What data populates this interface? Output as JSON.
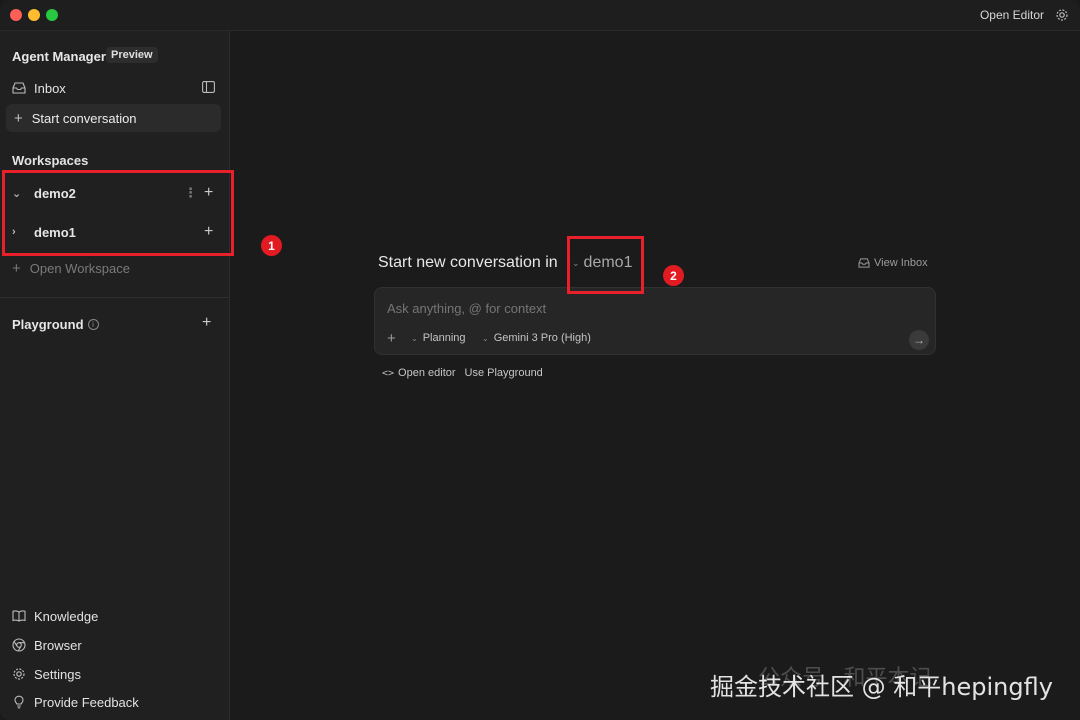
{
  "titlebar": {
    "open_editor": "Open Editor"
  },
  "sidebar": {
    "title": "Agent Manager",
    "badge": "Preview",
    "inbox": "Inbox",
    "start_conversation": "Start conversation",
    "workspaces_header": "Workspaces",
    "workspaces": [
      {
        "name": "demo2",
        "expanded": true
      },
      {
        "name": "demo1",
        "expanded": false
      }
    ],
    "open_workspace": "Open Workspace",
    "playground": "Playground",
    "bottom": {
      "knowledge": "Knowledge",
      "browser": "Browser",
      "settings": "Settings",
      "feedback": "Provide Feedback"
    }
  },
  "main": {
    "title": "Start new conversation in",
    "workspace_selected": "demo1",
    "view_inbox": "View Inbox",
    "composer": {
      "placeholder": "Ask anything, @ for context",
      "mode": "Planning",
      "model": "Gemini 3 Pro (High)"
    },
    "links": {
      "open_editor": "Open editor",
      "use_playground": "Use Playground"
    }
  },
  "annotations": {
    "one": "1",
    "two": "2",
    "color": "#e21b22"
  },
  "watermark": {
    "text": "掘金技术社区 @ 和平hepingfly",
    "faded": "公众号 · 和平本记"
  }
}
